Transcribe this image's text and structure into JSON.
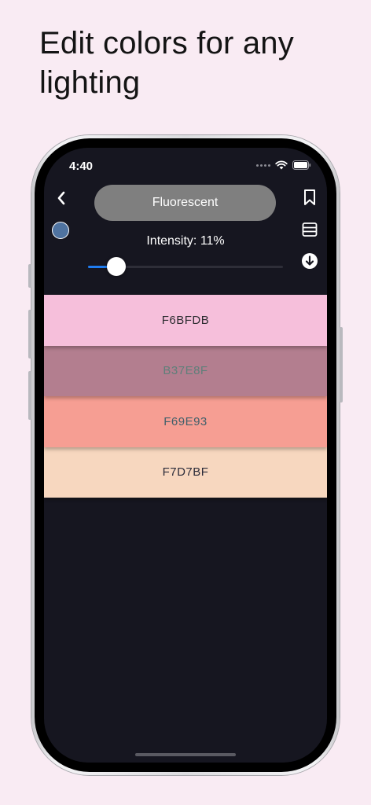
{
  "headline": {
    "line1": "Edit colors for any",
    "line2": "lighting"
  },
  "status_bar": {
    "time": "4:40"
  },
  "toolbar": {
    "mode_label": "Fluorescent",
    "intensity_label": "Intensity: 11%",
    "intensity_value": 0.11,
    "current_color": "#4f73a0"
  },
  "swatches": [
    {
      "hex_label": "F6BFDB",
      "color": "#F6BFDB",
      "text_color": "#2c2c30"
    },
    {
      "hex_label": "B37E8F",
      "color": "#B37E8F",
      "text_color": "#5f7f7a"
    },
    {
      "hex_label": "F69E93",
      "color": "#F69E93",
      "text_color": "#3f5f6a"
    },
    {
      "hex_label": "F7D7BF",
      "color": "#F7D7BF",
      "text_color": "#2c2c3a"
    }
  ],
  "icons": {
    "back": "chevron-left-icon",
    "bookmark": "bookmark-icon",
    "layout": "list-layout-icon",
    "download": "download-circle-icon",
    "wifi": "wifi-icon",
    "battery": "battery-icon"
  }
}
